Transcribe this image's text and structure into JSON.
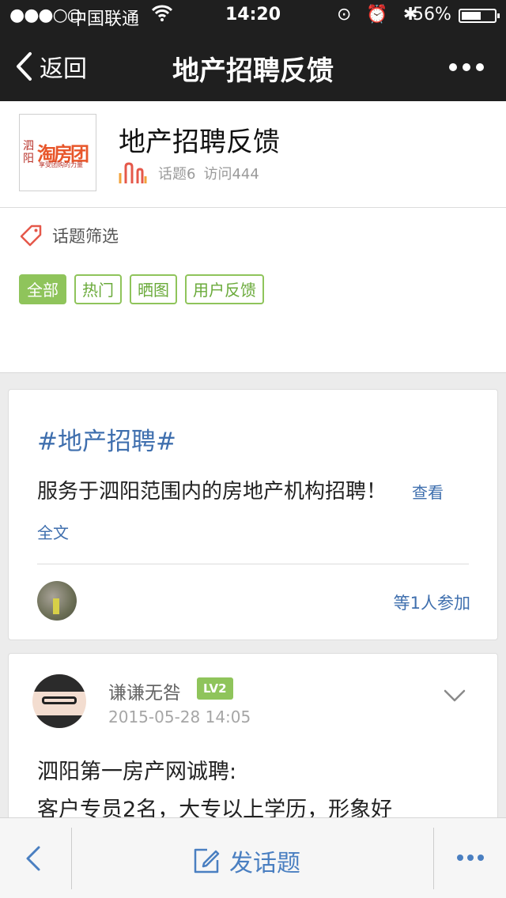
{
  "status_bar": {
    "signal": "●●●○○",
    "carrier": "中国联通",
    "wifi_icon": "wifi-icon",
    "time": "14:20",
    "status_icons": "⊙ ⏰ ✱",
    "battery_percent": "56%",
    "battery_level": 0.56
  },
  "nav": {
    "back_label": "返回",
    "title": "地产招聘反馈",
    "more_icon": "more-dots-icon"
  },
  "header": {
    "logo_text_left": "泗阳",
    "logo_text_main": "淘房团",
    "logo_tagline": "享受团购的力量",
    "title": "地产招聘反馈",
    "topics_stat": "话题6",
    "visits_stat": "访问444"
  },
  "filter": {
    "title": "话题筛选",
    "tags": [
      "全部",
      "热门",
      "晒图",
      "用户反馈"
    ],
    "active_index": 0
  },
  "topic": {
    "hashtag": "#地产招聘#",
    "description": "服务于泗阳范围内的房地产机构招聘！",
    "read_more": "查看全文",
    "participants": "等1人参加"
  },
  "post": {
    "username": "谦谦无咎",
    "level": "LV2",
    "timestamp": "2015-05-28 14:05",
    "body_line1": "泗阳第一房产网诚聘:",
    "body_line2": "客户专员2名，大专以上学历，形象好"
  },
  "toolbar": {
    "compose_label": "发话题"
  },
  "colors": {
    "nav_bg": "#1f1f1f",
    "accent_green": "#8fc45b",
    "link_blue": "#3f6fae",
    "toolbar_blue": "#4a7fc1"
  }
}
